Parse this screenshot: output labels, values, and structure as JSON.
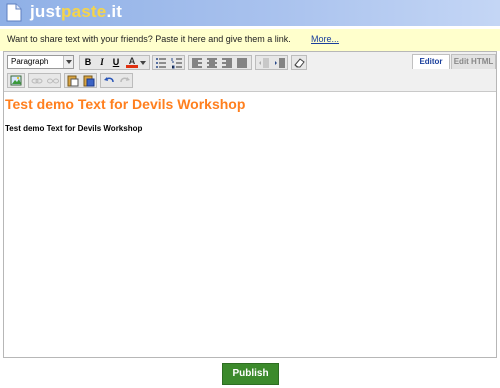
{
  "header": {
    "logo_prefix": "just",
    "logo_accent": "paste",
    "logo_suffix": ".it",
    "colors": {
      "bar": "#9bb7eb",
      "accent": "#f5d44a"
    }
  },
  "banner": {
    "text": "Want to share text with your friends? Paste it here and give them a link.",
    "link": "More..."
  },
  "toolbar": {
    "format_select": "Paragraph",
    "bold": "B",
    "italic": "I",
    "underline": "U",
    "text_color": "A",
    "icons": [
      "bullet-list-icon",
      "numbered-list-icon",
      "align-left-icon",
      "align-center-icon",
      "align-right-icon",
      "align-justify-icon",
      "outdent-icon",
      "indent-icon",
      "eraser-icon",
      "insert-image-icon",
      "link-icon",
      "unlink-icon",
      "paste-text-icon",
      "paste-word-icon",
      "undo-icon",
      "redo-icon"
    ]
  },
  "tabs": {
    "editor": "Editor",
    "html": "Edit HTML"
  },
  "content": {
    "heading": "Test demo Text for Devils Workshop",
    "paragraph": "Test demo Text for Devils Workshop",
    "colors": {
      "heading": "#ff7f1e"
    }
  },
  "publish_label": "Publish"
}
